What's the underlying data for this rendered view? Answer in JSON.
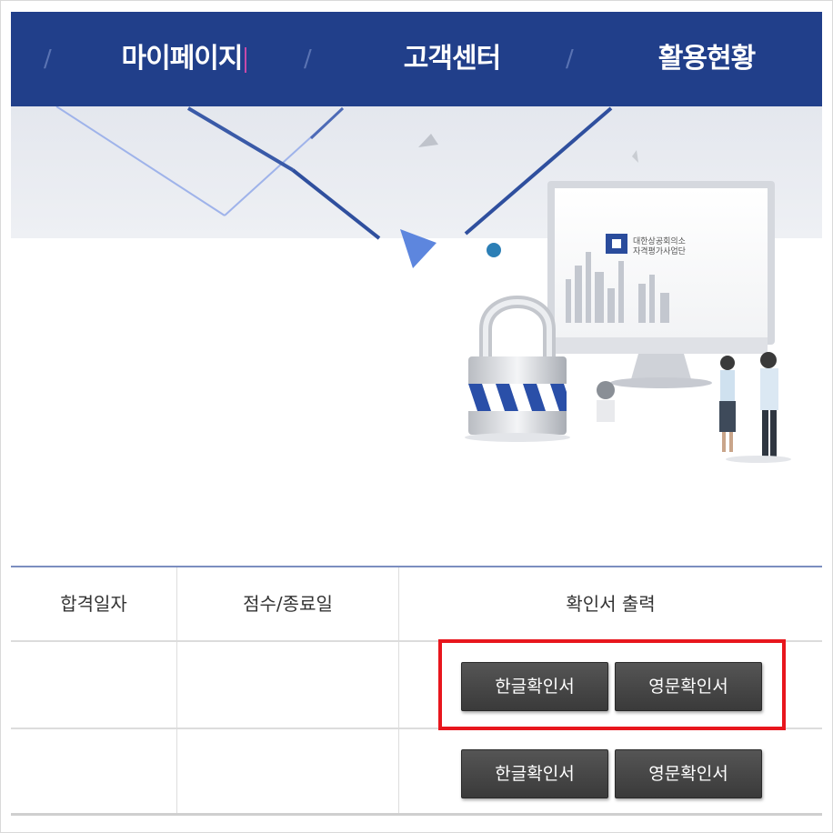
{
  "nav": {
    "items": [
      "마이페이지",
      "고객센터",
      "활용현황"
    ],
    "separator": "/"
  },
  "banner": {
    "logo_line1": "대한상공회의소",
    "logo_line2": "자격평가사업단"
  },
  "table": {
    "headers": [
      "합격일자",
      "점수/종료일",
      "확인서 출력"
    ],
    "rows": [
      {
        "pass_date": "",
        "score_end_date": "",
        "buttons": [
          "한글확인서",
          "영문확인서"
        ]
      },
      {
        "pass_date": "",
        "score_end_date": "",
        "buttons": [
          "한글확인서",
          "영문확인서"
        ]
      }
    ]
  },
  "colors": {
    "nav_bg": "#213f8a",
    "button_bg": "#444444",
    "highlight": "#e8161d"
  }
}
